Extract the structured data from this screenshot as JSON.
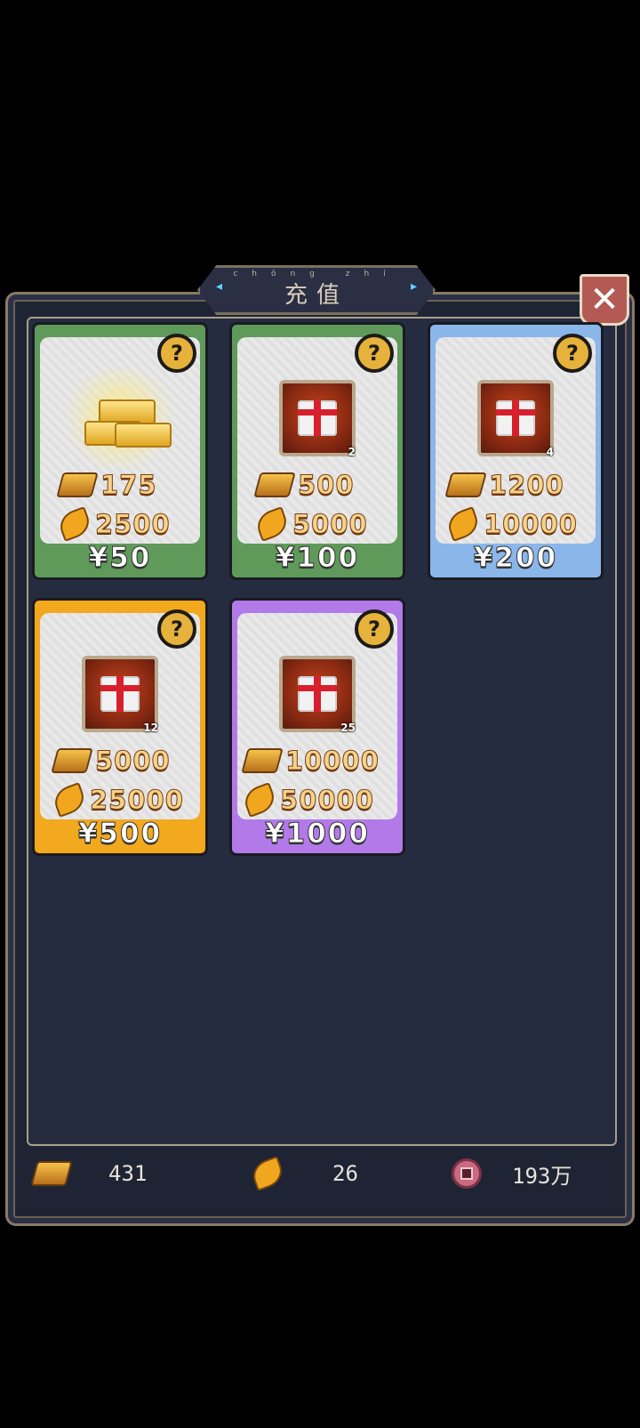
{
  "header": {
    "title": "充值",
    "pinyin": "chōng zhí",
    "close_icon": "close-icon"
  },
  "cards": [
    {
      "color": "green",
      "gold": "175",
      "leaf": "2500",
      "price": "¥50",
      "art": "gold-pile-icon"
    },
    {
      "color": "green",
      "gold": "500",
      "leaf": "5000",
      "price": "¥100",
      "art": "gift-box-icon",
      "gift_count": "2"
    },
    {
      "color": "blue",
      "gold": "1200",
      "leaf": "10000",
      "price": "¥200",
      "art": "gift-box-icon",
      "gift_count": "4"
    },
    {
      "color": "orange",
      "gold": "5000",
      "leaf": "25000",
      "price": "¥500",
      "art": "gift-box-icon",
      "gift_count": "12"
    },
    {
      "color": "purple",
      "gold": "10000",
      "leaf": "50000",
      "price": "¥1000",
      "art": "gift-box-icon",
      "gift_count": "25"
    }
  ],
  "footer": {
    "gold": "431",
    "leaf": "26",
    "coins": "193万"
  },
  "colors": {
    "green": "#5f9a5a",
    "blue": "#8ab6ea",
    "orange": "#f2a91e",
    "purple": "#b27ae8",
    "panel": "#262c40"
  }
}
